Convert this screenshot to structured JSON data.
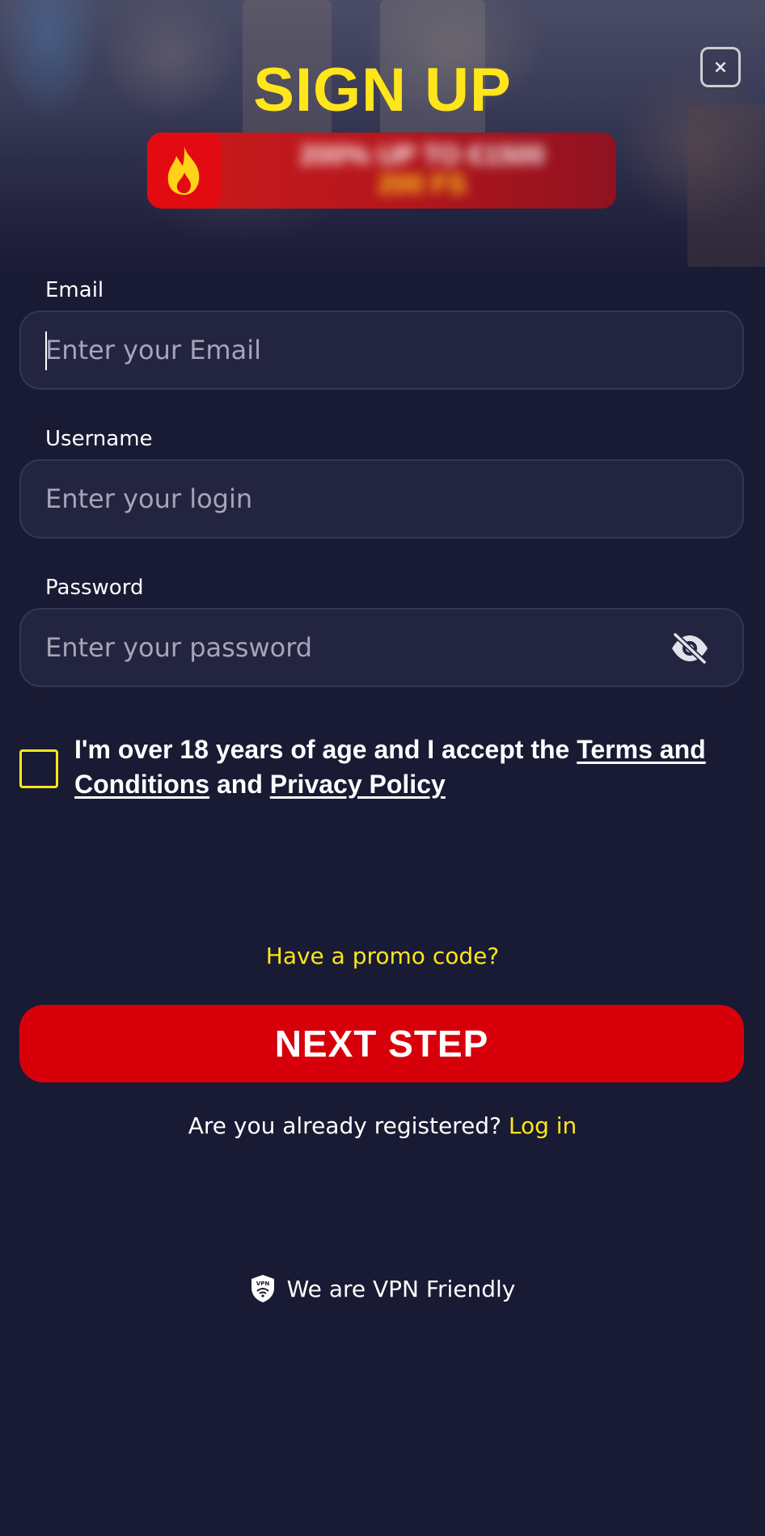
{
  "header": {
    "title": "SIGN UP",
    "close_symbol": "×"
  },
  "promo_banner": {
    "icon": "fire-icon",
    "line1": "200% UP TO €1500",
    "line2": "200 FS"
  },
  "form": {
    "email": {
      "label": "Email",
      "placeholder": "Enter your Email",
      "value": ""
    },
    "username": {
      "label": "Username",
      "placeholder": "Enter your login",
      "value": ""
    },
    "password": {
      "label": "Password",
      "placeholder": "Enter your password",
      "value": "",
      "toggle_icon": "eye-slash-icon"
    },
    "consent": {
      "checked": false,
      "text_before": "I'm over 18 years of age and I accept the ",
      "terms_link": "Terms and Conditions",
      "text_middle": " and ",
      "privacy_link": "Privacy Policy"
    }
  },
  "promo_code_link": "Have a promo code?",
  "next_button": "NEXT STEP",
  "login": {
    "question": "Are you already registered?",
    "link": "Log in"
  },
  "vpn": {
    "icon": "vpn-shield-icon",
    "text": "We are VPN Friendly"
  },
  "colors": {
    "background": "#191a33",
    "accent_yellow": "#ffe61a",
    "button_red": "#d7000a",
    "field_bg": "#232440"
  }
}
